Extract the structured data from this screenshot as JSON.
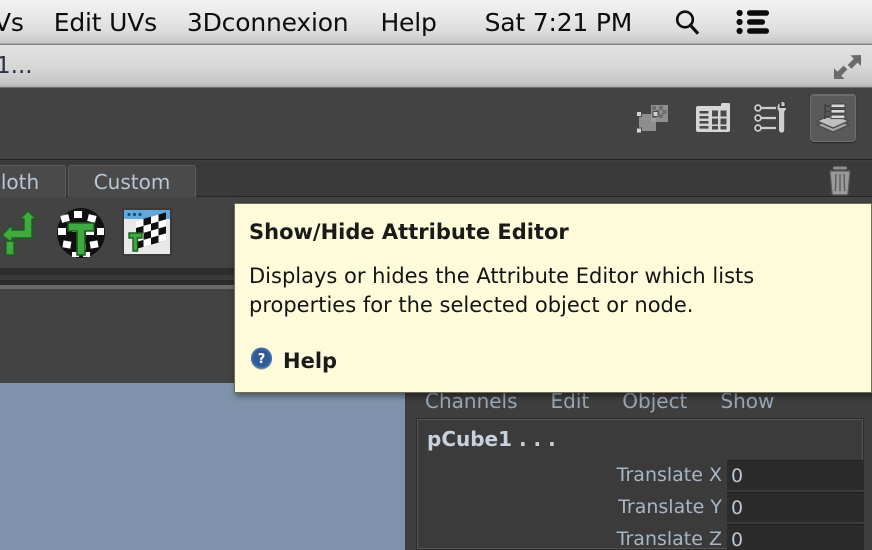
{
  "menubar": {
    "items": [
      {
        "label": "Vs"
      },
      {
        "label": "Edit UVs"
      },
      {
        "label": "3Dconnexion"
      },
      {
        "label": "Help"
      }
    ],
    "clock": "Sat 7:21 PM",
    "search_icon": "search-icon",
    "list_icon": "list-icon"
  },
  "window": {
    "title": "1...",
    "resize_icon": "fullscreen-arrows-icon"
  },
  "toolbar": {
    "buttons": [
      {
        "name": "modeling-toolkit-icon",
        "label": "Modeling Toolkit"
      },
      {
        "name": "attribute-spreadsheet-icon",
        "label": "Attribute Spread Sheet"
      },
      {
        "name": "tool-settings-icon",
        "label": "Tool Settings"
      },
      {
        "name": "attribute-editor-icon",
        "label": "Attribute Editor",
        "pressed": true
      }
    ],
    "trash_icon": "trash-icon"
  },
  "shelf": {
    "tabs": [
      {
        "label": "loth"
      },
      {
        "label": "Custom"
      }
    ],
    "icons": [
      {
        "name": "uv-arrow-icon"
      },
      {
        "name": "uv-checker-sphere-icon"
      },
      {
        "name": "uv-editor-window-icon"
      }
    ]
  },
  "tooltip": {
    "title": "Show/Hide Attribute Editor",
    "body": "Displays or hides the Attribute Editor which lists properties for the selected object or node.",
    "help_label": "Help",
    "help_icon": "help-question-icon",
    "background": "#fdfbd9"
  },
  "channel_box": {
    "menus": [
      "Channels",
      "Edit",
      "Object",
      "Show"
    ],
    "node_name": "pCube1 . . .",
    "rows": [
      {
        "label": "Translate X",
        "value": "0"
      },
      {
        "label": "Translate Y",
        "value": "0"
      },
      {
        "label": "Translate Z",
        "value": "0"
      }
    ]
  },
  "viewport": {
    "background": "#7f92ab"
  }
}
